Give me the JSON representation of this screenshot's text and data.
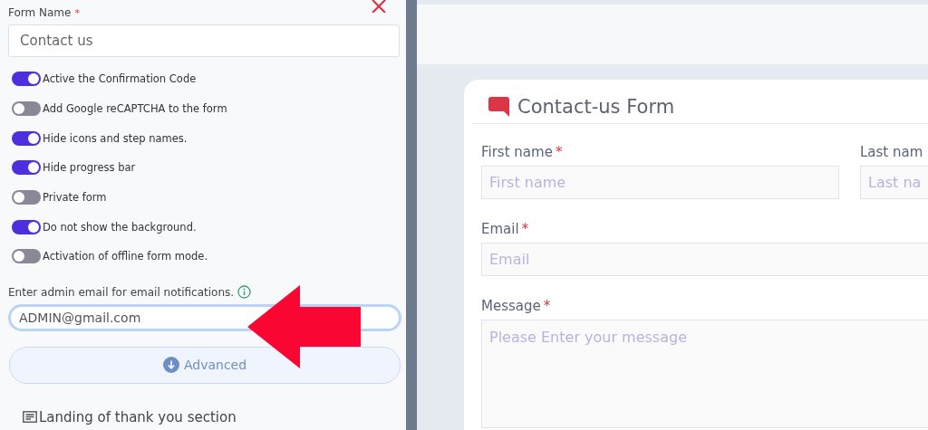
{
  "settings_panel": {
    "form_name_label": "Form Name",
    "form_name_required_mark": "*",
    "form_name_value": "Contact us",
    "toggles": [
      {
        "label": "Active the Confirmation Code",
        "on": true
      },
      {
        "label": "Add Google reCAPTCHA to the form",
        "on": false
      },
      {
        "label": "Hide icons and step names.",
        "on": true
      },
      {
        "label": "Hide progress bar",
        "on": true
      },
      {
        "label": "Private form",
        "on": false
      },
      {
        "label": "Do not show the background.",
        "on": true
      },
      {
        "label": "Activation of offline form mode.",
        "on": false
      }
    ],
    "admin_email_label": "Enter admin email for email notifications.",
    "admin_email_value": "ADMIN@gmail.com",
    "advanced_button": "Advanced",
    "section_title": "Landing of thank you section"
  },
  "preview": {
    "title": "Contact-us Form",
    "fields": [
      {
        "label": "First name",
        "required_mark": "*",
        "placeholder": "First name",
        "kind": "input"
      },
      {
        "label": "Last nam",
        "placeholder": "Last na",
        "kind": "input"
      },
      {
        "label": "Email",
        "required_mark": "*",
        "placeholder": "Email",
        "kind": "input"
      },
      {
        "label": "Message",
        "required_mark": "*",
        "placeholder": "Please Enter your message",
        "kind": "textarea"
      }
    ]
  }
}
